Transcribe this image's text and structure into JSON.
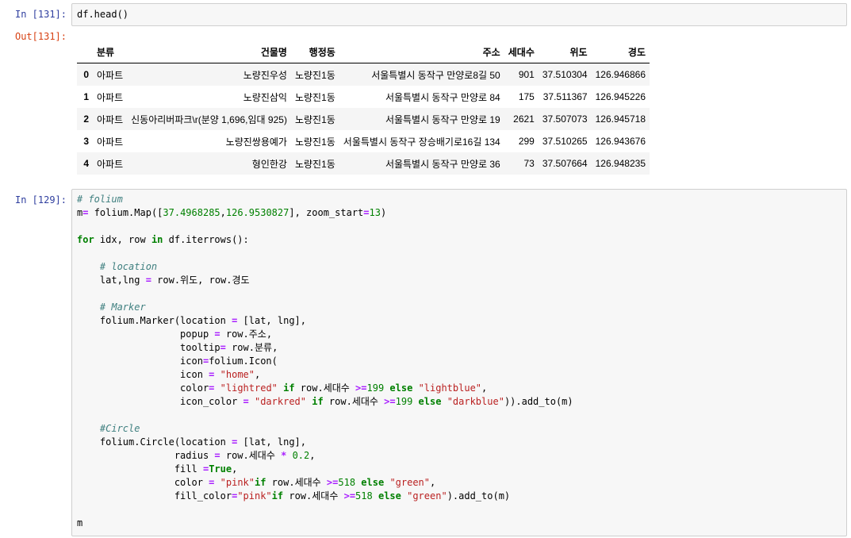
{
  "cell1": {
    "prompt": "In [131]:",
    "code": "df.head()"
  },
  "output": {
    "prompt": "Out[131]:",
    "columns": [
      "",
      "분류",
      "건물명",
      "행정동",
      "주소",
      "세대수",
      "위도",
      "경도"
    ],
    "rows": [
      {
        "idx": "0",
        "type": "아파트",
        "name": "노량진우성",
        "dong": "노량진1동",
        "addr": "서울특별시 동작구 만양로8길 50",
        "units": "901",
        "lat": "37.510304",
        "lng": "126.946866"
      },
      {
        "idx": "1",
        "type": "아파트",
        "name": "노량진삼익",
        "dong": "노량진1동",
        "addr": "서울특별시 동작구 만양로 84",
        "units": "175",
        "lat": "37.511367",
        "lng": "126.945226"
      },
      {
        "idx": "2",
        "type": "아파트",
        "name": "신동아리버파크\\r(분양 1,696,임대 925)",
        "dong": "노량진1동",
        "addr": "서울특별시 동작구 만양로 19",
        "units": "2621",
        "lat": "37.507073",
        "lng": "126.945718"
      },
      {
        "idx": "3",
        "type": "아파트",
        "name": "노량진쌍용예가",
        "dong": "노량진1동",
        "addr": "서울특별시 동작구 장승배기로16길 134",
        "units": "299",
        "lat": "37.510265",
        "lng": "126.943676"
      },
      {
        "idx": "4",
        "type": "아파트",
        "name": "형인한강",
        "dong": "노량진1동",
        "addr": "서울특별시 동작구 만양로 36",
        "units": "73",
        "lat": "37.507664",
        "lng": "126.948235"
      }
    ]
  },
  "cell2": {
    "prompt": "In [129]:"
  }
}
